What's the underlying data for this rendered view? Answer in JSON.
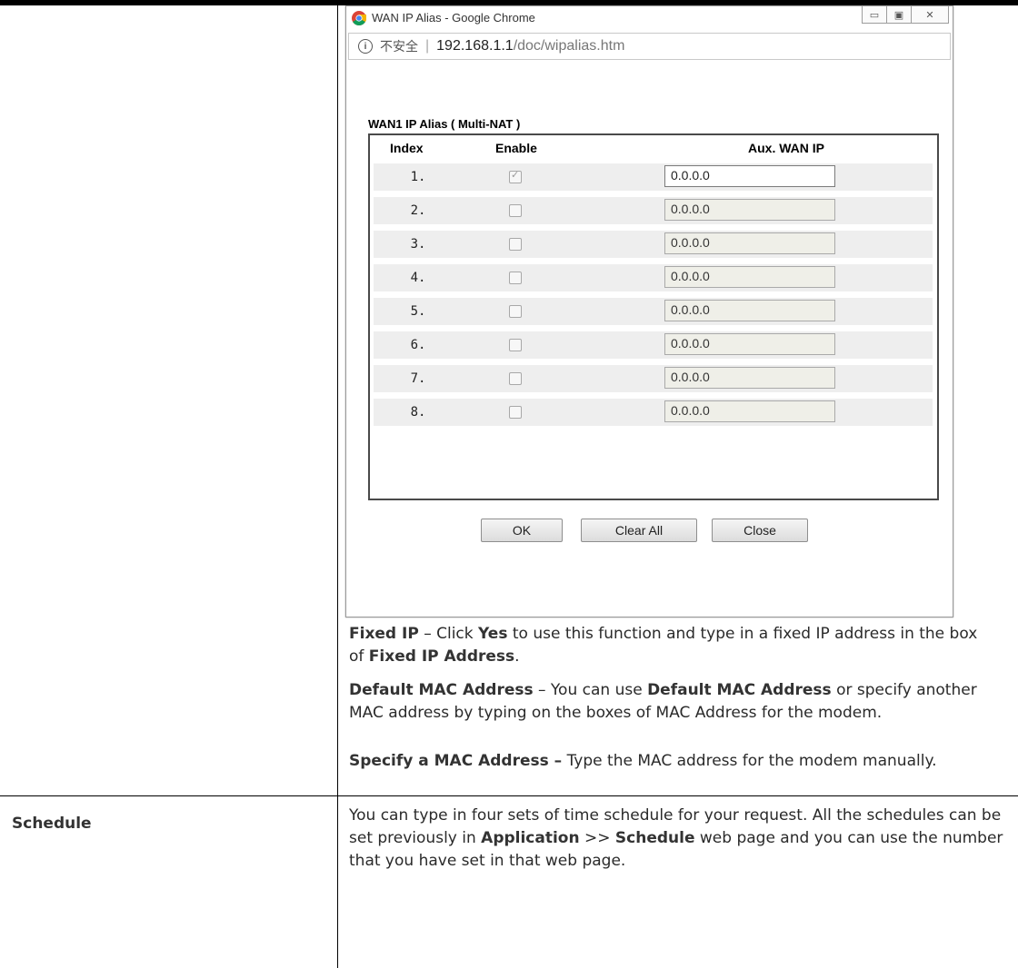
{
  "popup": {
    "window_title": "WAN IP Alias - Google Chrome",
    "controls": {
      "minimize": "▭",
      "maximize": "▣",
      "close": "✕"
    },
    "address_bar": {
      "insecure_label": "不安全",
      "separator": "|",
      "url_host": "192.168.1.1",
      "url_path": "/doc/wipalias.htm"
    },
    "section_title": "WAN1  IP Alias ( Multi-NAT )",
    "table": {
      "headers": {
        "index": "Index",
        "enable": "Enable",
        "aux_wan_ip": "Aux. WAN IP"
      },
      "rows": [
        {
          "index": "1.",
          "enabled": true,
          "ip": "0.0.0.0"
        },
        {
          "index": "2.",
          "enabled": false,
          "ip": "0.0.0.0"
        },
        {
          "index": "3.",
          "enabled": false,
          "ip": "0.0.0.0"
        },
        {
          "index": "4.",
          "enabled": false,
          "ip": "0.0.0.0"
        },
        {
          "index": "5.",
          "enabled": false,
          "ip": "0.0.0.0"
        },
        {
          "index": "6.",
          "enabled": false,
          "ip": "0.0.0.0"
        },
        {
          "index": "7.",
          "enabled": false,
          "ip": "0.0.0.0"
        },
        {
          "index": "8.",
          "enabled": false,
          "ip": "0.0.0.0"
        }
      ]
    },
    "buttons": {
      "ok": "OK",
      "clear_all": "Clear All",
      "close": "Close"
    }
  },
  "doc": {
    "fixed_ip": {
      "term": "Fixed IP",
      "t1": " – Click ",
      "yes": "Yes",
      "t2": " to use this function and type in a fixed IP address in the box of ",
      "field": "Fixed IP Address",
      "t3": "."
    },
    "default_mac": {
      "term": "Default MAC Address",
      "t1": " – You can use ",
      "term2": "Default MAC Address",
      "t2": " or specify another MAC address by typing on the boxes of MAC Address for the modem."
    },
    "specify_mac": {
      "term": "Specify a MAC Address –",
      "t1": " Type the MAC address for the modem manually."
    },
    "schedule": {
      "label": "Schedule",
      "t1": "You can type in four sets of time schedule for your request. All the schedules can be set previously in ",
      "app": "Application",
      "t2": " >> ",
      "sched": "Schedule",
      "t3": " web page and you can use the number that you have set in that web page."
    }
  }
}
